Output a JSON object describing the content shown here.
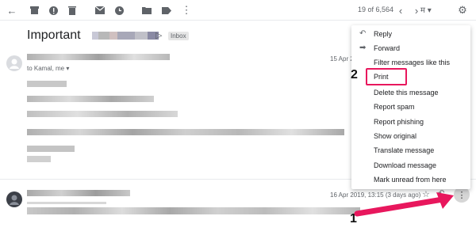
{
  "toolbar": {
    "icons": [
      "back-arrow-icon",
      "archive-icon",
      "report-spam-icon",
      "delete-icon",
      "mark-unread-icon",
      "snooze-icon",
      "move-to-icon",
      "label-icon",
      "more-vert-icon"
    ],
    "pager": "19 of 6,564",
    "lang_glyph": "म",
    "settings_icon": "gear-icon"
  },
  "subject": {
    "title": "Important",
    "label": "Inbox"
  },
  "message1": {
    "to_line": "to Kamal, me",
    "date": "15 Apr 2"
  },
  "message2": {
    "date": "16 Apr 2019, 13:15 (3 days ago)"
  },
  "menu": {
    "items": [
      {
        "label": "Reply",
        "icon": "reply-icon"
      },
      {
        "label": "Forward",
        "icon": "forward-icon"
      },
      {
        "label": "Filter messages like this",
        "icon": ""
      },
      {
        "label": "Print",
        "icon": ""
      },
      {
        "label": "Delete this message",
        "icon": ""
      },
      {
        "label": "Report spam",
        "icon": ""
      },
      {
        "label": "Report phishing",
        "icon": ""
      },
      {
        "label": "Show original",
        "icon": ""
      },
      {
        "label": "Translate message",
        "icon": ""
      },
      {
        "label": "Download message",
        "icon": ""
      },
      {
        "label": "Mark unread from here",
        "icon": ""
      }
    ]
  },
  "annotations": {
    "step1": "1",
    "step2": "2",
    "accent": "#e8175d"
  }
}
